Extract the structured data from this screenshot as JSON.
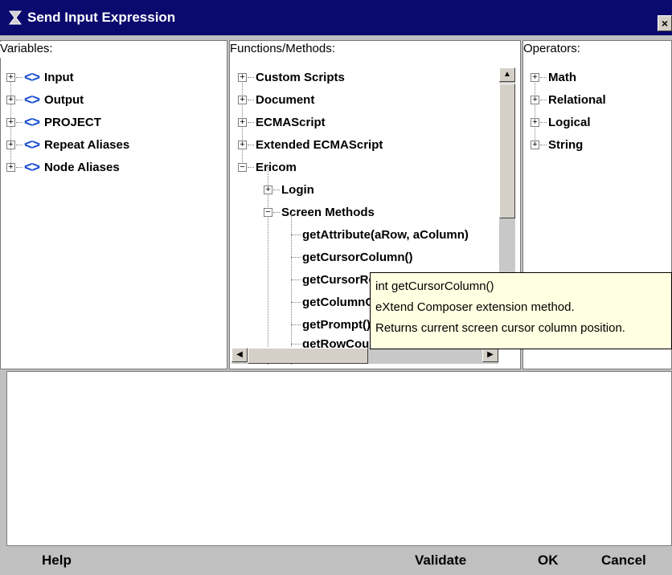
{
  "window": {
    "title": "Send Input Expression",
    "close_glyph": "×"
  },
  "variables": {
    "label": "Variables:",
    "items": [
      {
        "label": "Input",
        "icon": "<>"
      },
      {
        "label": "Output",
        "icon": "<>"
      },
      {
        "label": "PROJECT",
        "icon": "<>"
      },
      {
        "label": "Repeat Aliases",
        "icon": "<>"
      },
      {
        "label": "Node Aliases",
        "icon": "<>"
      }
    ]
  },
  "functions": {
    "label": "Functions/Methods:",
    "items": [
      {
        "label": "Custom Scripts",
        "expanded": false
      },
      {
        "label": "Document",
        "expanded": false
      },
      {
        "label": "ECMAScript",
        "expanded": false
      },
      {
        "label": "Extended ECMAScript",
        "expanded": false
      },
      {
        "label": "Ericom",
        "expanded": true
      }
    ],
    "ericom_children": [
      {
        "label": "Login",
        "expanded": false
      },
      {
        "label": "Screen Methods",
        "expanded": true
      }
    ],
    "screen_methods": [
      "getAttribute(aRow, aColumn)",
      "getCursorColumn()",
      "getCursorRow()",
      "getColumnCount()",
      "getPrompt()",
      "getRowCount()"
    ]
  },
  "operators": {
    "label": "Operators:",
    "items": [
      "Math",
      "Relational",
      "Logical",
      "String"
    ]
  },
  "tooltip": {
    "signature": "int getCursorColumn()",
    "kind": "eXtend Composer extension method.",
    "description": "Returns current screen cursor column position."
  },
  "expression": {
    "value": ""
  },
  "buttons": {
    "help": "Help",
    "validate": "Validate",
    "ok": "OK",
    "cancel": "Cancel"
  },
  "glyphs": {
    "plus": "+",
    "minus": "−",
    "up": "▲",
    "down": "▼",
    "left": "◀",
    "right": "▶"
  },
  "colors": {
    "titlebar": "#0a0a6e",
    "tooltip_bg": "#ffffe1",
    "variable_icon": "#1a4fd0"
  }
}
